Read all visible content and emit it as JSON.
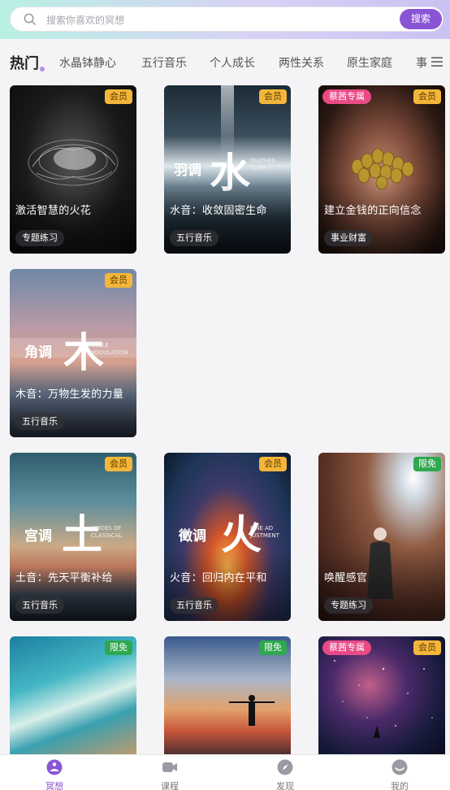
{
  "search": {
    "placeholder": "搜索你喜欢的冥想",
    "button": "搜索"
  },
  "tabs": [
    "热门",
    "水晶钵静心",
    "五行音乐",
    "个人成长",
    "两性关系",
    "原生家庭",
    "事"
  ],
  "badges": {
    "member": "会员",
    "free": "限免",
    "exclusive": "蔡茜专属"
  },
  "cards": [
    {
      "title": "激活智慧的火花",
      "tag": "专题练习"
    },
    {
      "title": "水音：收敛固密生命",
      "tag": "五行音乐",
      "calli_zh": "羽调",
      "calli_big": "水",
      "calli_en": [
        "FEATHER",
        "TONE"
      ]
    },
    {
      "title": "建立金钱的正向信念",
      "tag": "事业财富"
    },
    {
      "title": "木音：万物生发的力量",
      "tag": "五行音乐",
      "calli_zh": "角调",
      "calli_big": "木",
      "calli_en": [
        "ANGLE",
        "MODULATION"
      ]
    },
    {
      "title": "土音：先天平衡补给",
      "tag": "五行音乐",
      "calli_zh": "宫调",
      "calli_big": "土",
      "calli_en": [
        "MODES OF",
        "CLASSICAL"
      ]
    },
    {
      "title": "火音：回归内在平和",
      "tag": "五行音乐",
      "calli_zh": "徵调",
      "calli_big": "火",
      "calli_en": [
        "FINE AD",
        "JUSTMENT"
      ]
    },
    {
      "title": "唤醒感官",
      "tag": "专题练习"
    }
  ],
  "nav": [
    "冥想",
    "课程",
    "发现",
    "我的"
  ],
  "colors": {
    "accent": "#8a55d4",
    "member": "#f3b63a",
    "free": "#2fa84f",
    "exclusive": "#e94a86"
  }
}
